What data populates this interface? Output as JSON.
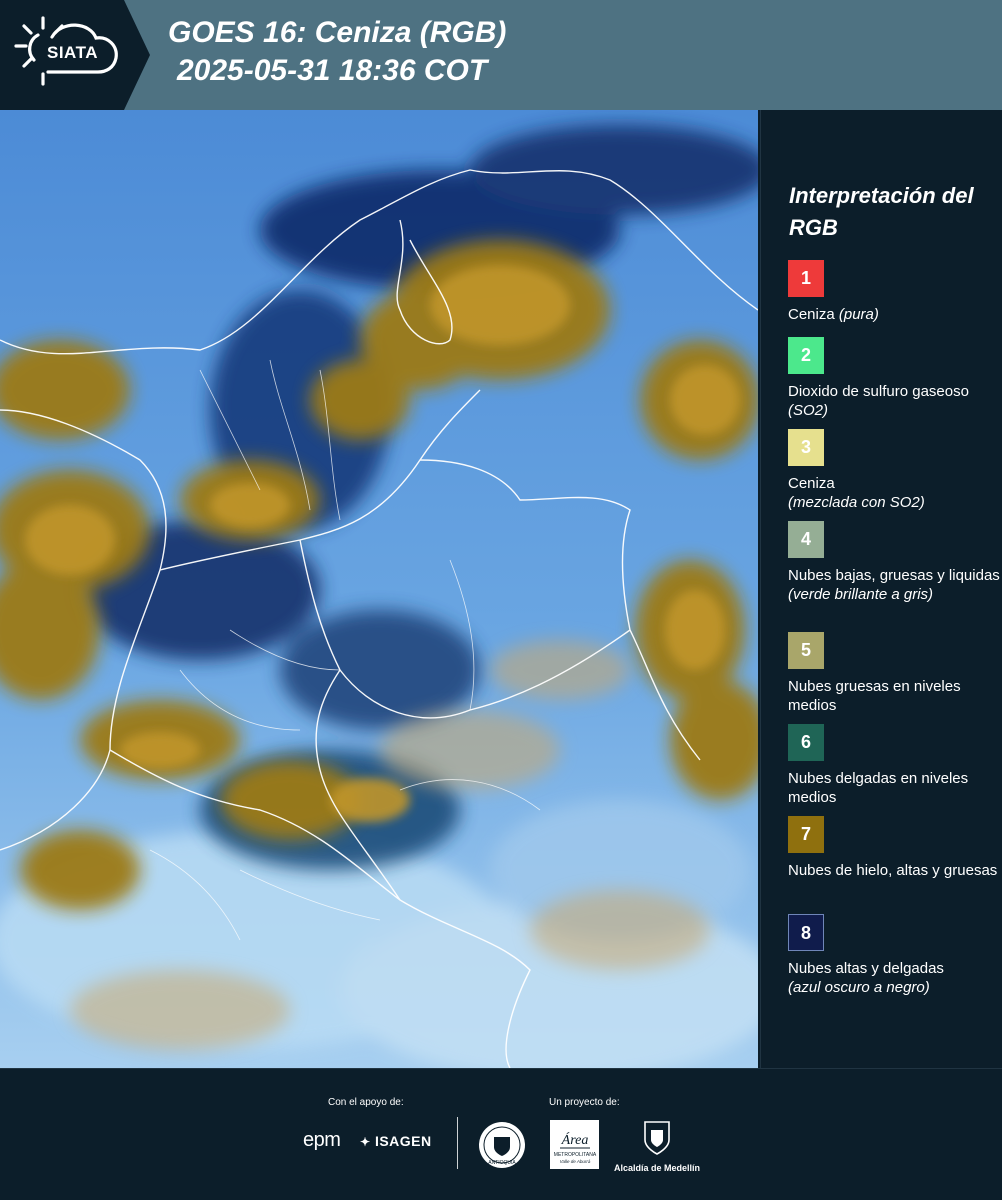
{
  "header": {
    "logo_text": "SIATA",
    "title_line1": "GOES 16: Ceniza (RGB)",
    "title_line2": "2025-05-31 18:36 COT"
  },
  "map": {
    "image": "goes16-ash-rgb-satellite-composite",
    "background_color": "#5d95d6"
  },
  "legend": {
    "title": "Interpretación del RGB",
    "items": [
      {
        "number": "1",
        "color": "#ee3a3a",
        "label": "Ceniza",
        "note": "(pura)"
      },
      {
        "number": "2",
        "color": "#4ce88c",
        "label": "Dioxido de sulfuro gaseoso",
        "note": "(SO2)"
      },
      {
        "number": "3",
        "color": "#e6e08e",
        "label": "Ceniza",
        "note": "(mezclada con SO2)"
      },
      {
        "number": "4",
        "color": "#95ae95",
        "label": "Nubes bajas, gruesas y liquidas",
        "note": "(verde brillante a gris)"
      },
      {
        "number": "5",
        "color": "#a9a66a",
        "label": "Nubes gruesas en niveles medios",
        "note": ""
      },
      {
        "number": "6",
        "color": "#1f6556",
        "label": "Nubes delgadas en niveles medios",
        "note": ""
      },
      {
        "number": "7",
        "color": "#8f700e",
        "label": "Nubes de hielo, altas y gruesas",
        "note": ""
      },
      {
        "number": "8",
        "color": "#101c4c",
        "label": "Nubes altas y delgadas",
        "note": "(azul oscuro a negro)"
      }
    ]
  },
  "footer": {
    "support_label": "Con el apoyo de:",
    "project_label": "Un proyecto de:",
    "sponsor_1": "epm",
    "sponsor_2": "ISAGEN",
    "project_1_lines": [
      "METROPOLITANA",
      "Valle de Aburrá"
    ],
    "project_2_label": "Alcaldía de Medellín",
    "area_logo_mark": "Área",
    "seal_text": "ANTIOQUIA"
  }
}
